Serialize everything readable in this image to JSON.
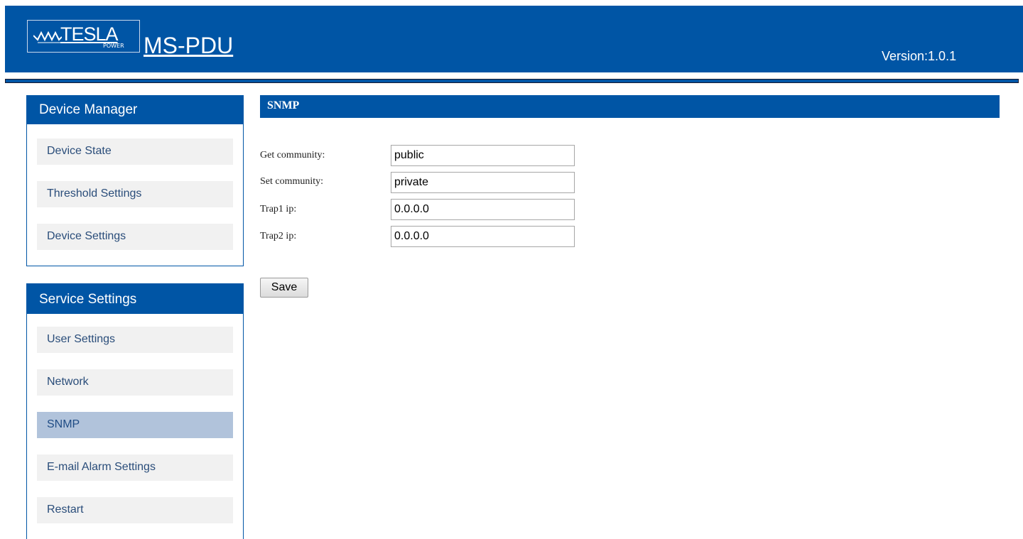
{
  "header": {
    "logo_text": "TESLA",
    "logo_sub": "POWER",
    "app_title": "MS-PDU",
    "version_label": "Version:",
    "version_value": "1.0.1"
  },
  "sidebar": {
    "device_manager": {
      "title": "Device Manager",
      "items": [
        {
          "label": "Device State"
        },
        {
          "label": "Threshold Settings"
        },
        {
          "label": "Device Settings"
        }
      ]
    },
    "service_settings": {
      "title": "Service Settings",
      "items": [
        {
          "label": "User Settings"
        },
        {
          "label": "Network"
        },
        {
          "label": "SNMP",
          "active": true
        },
        {
          "label": "E-mail Alarm Settings"
        },
        {
          "label": "Restart"
        }
      ]
    }
  },
  "content": {
    "title": "SNMP",
    "fields": [
      {
        "label": "Get community:",
        "value": "public"
      },
      {
        "label": "Set community:",
        "value": "private"
      },
      {
        "label": "Trap1 ip:",
        "value": "0.0.0.0"
      },
      {
        "label": "Trap2 ip:",
        "value": "0.0.0.0"
      }
    ],
    "save_label": "Save"
  },
  "colors": {
    "brand_blue": "#0055a5",
    "menu_bg": "#f1f1f1",
    "menu_active_bg": "#b1c3db"
  }
}
